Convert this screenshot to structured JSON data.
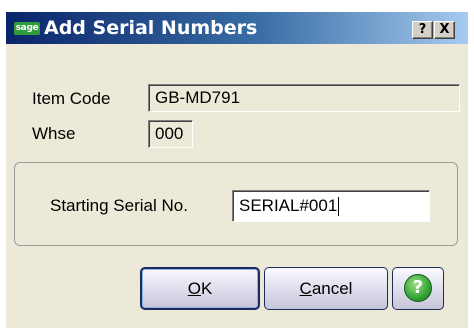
{
  "window": {
    "logo_text": "sage",
    "title": "Add Serial Numbers",
    "help_caption": "?",
    "close_caption": "X"
  },
  "form": {
    "item_code_label": "Item Code",
    "item_code_value": "GB-MD791",
    "whse_label": "Whse",
    "whse_value": "000",
    "starting_serial_label": "Starting Serial No.",
    "starting_serial_value": "SERIAL#001"
  },
  "buttons": {
    "ok_mnemonic": "O",
    "ok_rest": "K",
    "cancel_mnemonic": "C",
    "cancel_rest": "ancel",
    "help_symbol": "?"
  },
  "colors": {
    "help_icon": "#3aa83a",
    "title_bar": "#0a246a"
  }
}
